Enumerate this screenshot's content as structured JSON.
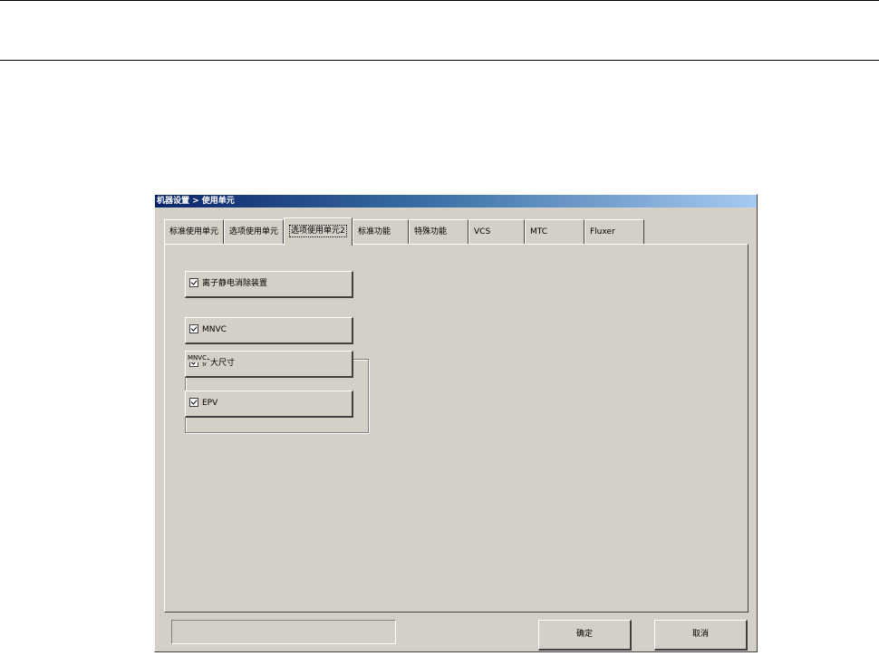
{
  "window": {
    "title": "机器设置 > 使用单元"
  },
  "tabs": [
    {
      "label": "标准使用单元"
    },
    {
      "label": "选项使用单元"
    },
    {
      "label": "选项使用单元2"
    },
    {
      "label": "标准功能"
    },
    {
      "label": "特殊功能"
    },
    {
      "label": "VCS"
    },
    {
      "label": "MTC"
    },
    {
      "label": "Fluxer"
    }
  ],
  "active_tab": 2,
  "options": {
    "ionizer": {
      "label": "离子静电消除装置",
      "checked": true
    },
    "group_label": "MNVC",
    "mnvc": {
      "label": "MNVC",
      "checked": true
    },
    "expand_size": {
      "label": "扩大尺寸",
      "checked": true
    },
    "epv": {
      "label": "EPV",
      "checked": true
    }
  },
  "status_text": "",
  "buttons": {
    "ok": "确定",
    "cancel": "取消"
  },
  "colors": {
    "face": "#d4d0c8",
    "title_start": "#0a246a",
    "title_end": "#a6caf0"
  }
}
